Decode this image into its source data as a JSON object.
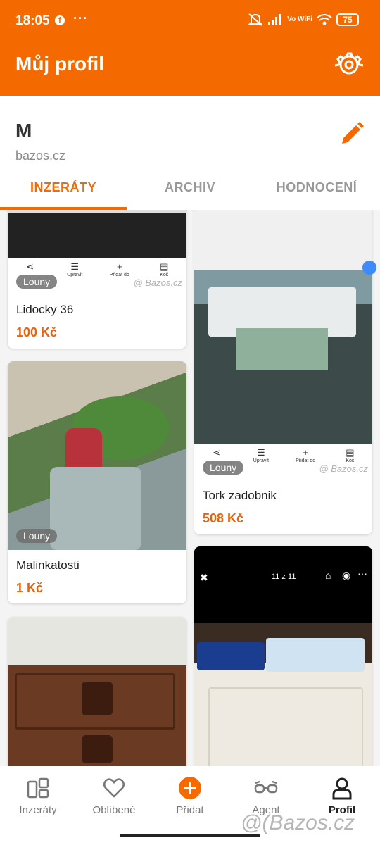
{
  "status_bar": {
    "time": "18:05",
    "fb": "f",
    "more": "···",
    "wifi_label": "Vo WiFi",
    "battery": "75"
  },
  "header": {
    "title": "Můj profil",
    "settings_icon": "gear-icon"
  },
  "profile": {
    "name": "M",
    "site": "bazos.cz",
    "edit_icon": "pencil-icon"
  },
  "tabs": [
    {
      "label": "INZERÁTY",
      "active": true
    },
    {
      "label": "ARCHIV",
      "active": false
    },
    {
      "label": "HODNOCENÍ",
      "active": false
    }
  ],
  "actions": {
    "share": "",
    "edit": "Upravit",
    "add": "Přidat do",
    "trash": "Koš",
    "watermark": "@ Bazos.cz"
  },
  "listings": [
    {
      "title": "Lidocky 36",
      "price": "100 Kč",
      "location": "Louny"
    },
    {
      "title": "Tork zadobnik",
      "price": "508 Kč",
      "location": "Louny"
    },
    {
      "title": "Malinkatosti",
      "price": "1 Kč",
      "location": "Louny"
    },
    {
      "title": "",
      "price": "",
      "location": ""
    },
    {
      "title": "",
      "price": "",
      "location": "",
      "overlay_counter": "11 z 11"
    }
  ],
  "bottom_nav": [
    {
      "label": "Inzeráty",
      "icon": "listings-icon",
      "active": false
    },
    {
      "label": "Oblíbené",
      "icon": "heart-icon",
      "active": false
    },
    {
      "label": "Přidat",
      "icon": "plus-circle-icon",
      "active": false
    },
    {
      "label": "Agent",
      "icon": "glasses-icon",
      "active": false
    },
    {
      "label": "Profil",
      "icon": "person-icon",
      "active": true
    }
  ],
  "watermark": "@(Bazos.cz",
  "colors": {
    "brand": "#f56a00",
    "price": "#e8630a"
  }
}
